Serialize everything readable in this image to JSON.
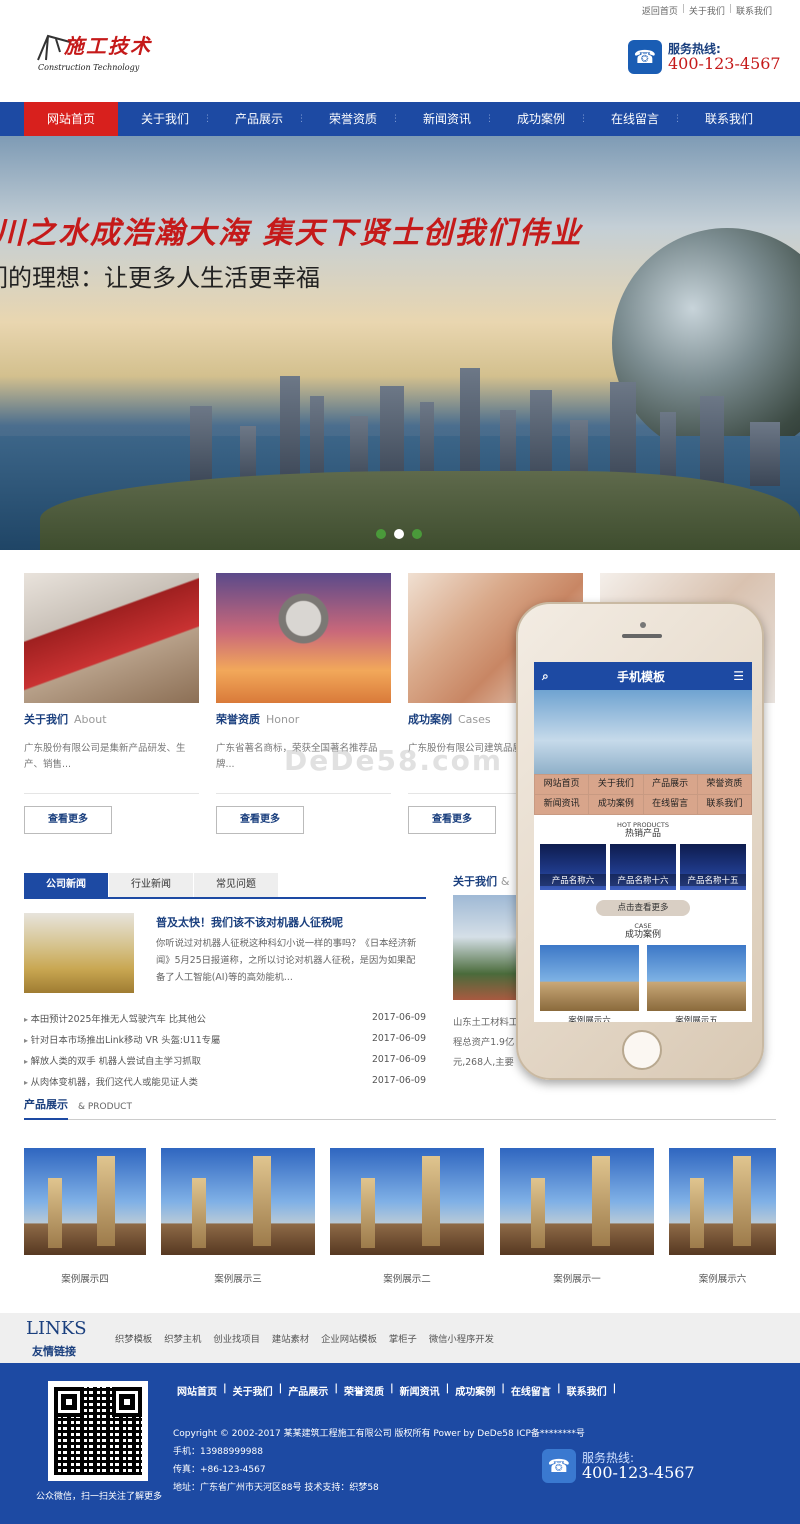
{
  "top_links": [
    "返回首页",
    "关于我们",
    "联系我们"
  ],
  "logo": {
    "cn": "施工技术",
    "en": "Construction Technology"
  },
  "hotline": {
    "label": "服务热线:",
    "number": "400-123-4567"
  },
  "nav": [
    "网站首页",
    "关于我们",
    "产品展示",
    "荣誉资质",
    "新闻资讯",
    "成功案例",
    "在线留言",
    "联系我们"
  ],
  "banner": {
    "slogan1": "纳百川之水成浩瀚大海 集天下贤士创我们伟业",
    "slogan2": "我们的理想：让更多人生活更幸福",
    "slides": 3,
    "active_slide": 2
  },
  "cards": [
    {
      "title": "关于我们",
      "en": "About",
      "desc": "广东股份有限公司是集新产品研发、生产、销售...",
      "button": "查看更多"
    },
    {
      "title": "荣誉资质",
      "en": "Honor",
      "desc": "广东省著名商标，荣获全国著名推荐品牌...",
      "button": "查看更多"
    },
    {
      "title": "成功案例",
      "en": "Cases",
      "desc": "广东股份有限公司建筑品质...",
      "button": "查看更多"
    }
  ],
  "news": {
    "tabs": [
      "公司新闻",
      "行业新闻",
      "常见问题"
    ],
    "featured": {
      "title": "普及太快！我们该不该对机器人征税呢",
      "text": "你听说过对机器人征税这种科幻小说一样的事吗？《日本经济新闻》5月25日报道称，之所以讨论对机器人征税，是因为如果配备了人工智能(AI)等的高効能机..."
    },
    "list": [
      {
        "title": "本田预计2025年推无人驾驶汽车 比其他公",
        "date": "2017-06-09"
      },
      {
        "title": "针对日本市场推出Link移动 VR 头盔:U11专屬",
        "date": "2017-06-09"
      },
      {
        "title": "解放人类的双手 机器人尝试自主学习抓取",
        "date": "2017-06-09"
      },
      {
        "title": "从肉体变机器，我们这代人或能见证人类",
        "date": "2017-06-09"
      }
    ]
  },
  "about": {
    "title": "关于我们",
    "suffix": "&",
    "text": "山东土工材料工程总资产1.9亿元,268人,主要设备全"
  },
  "mobile": {
    "title": "手机模板",
    "nav": [
      "网站首页",
      "关于我们",
      "产品展示",
      "荣誉资质",
      "新闻资讯",
      "成功案例",
      "在线留言",
      "联系我们"
    ],
    "hot_en": "HOT PRODUCTS",
    "hot_cn": "热销产品",
    "products": [
      "产品名称六",
      "产品名称十六",
      "产品名称十五"
    ],
    "more": "点击查看更多",
    "case_en": "CASE",
    "case_cn": "成功案例",
    "cases": [
      "案例展示六",
      "案例展示五"
    ]
  },
  "products": {
    "title": "产品展示",
    "en": "& PRODUCT",
    "items": [
      "案例展示四",
      "案例展示三",
      "案例展示二",
      "案例展示一",
      "案例展示六"
    ]
  },
  "links": {
    "title_en": "LINKS",
    "title_cn": "友情链接",
    "items": [
      "织梦模板",
      "织梦主机",
      "创业找项目",
      "建站素材",
      "企业网站模板",
      "掌柜子",
      "微信小程序开发"
    ]
  },
  "footer": {
    "nav": [
      "网站首页",
      "关于我们",
      "产品展示",
      "荣誉资质",
      "新闻资讯",
      "成功案例",
      "在线留言",
      "联系我们"
    ],
    "copyright": "Copyright © 2002-2017 某某建筑工程施工有限公司 版权所有 Power by DeDe58 ICP备********号",
    "phone": "手机：13988999988",
    "fax": "传真：+86-123-4567",
    "address": "地址：广东省广州市天河区88号 技术支持：织梦58",
    "qr_caption": "公众微信，扫一扫关注了解更多",
    "hotline_label": "服务热线:",
    "hotline_number": "400-123-4567"
  },
  "watermark": "DeDe58.com",
  "colors": {
    "brand_blue": "#1d4aa3",
    "accent_red": "#d8201d"
  }
}
